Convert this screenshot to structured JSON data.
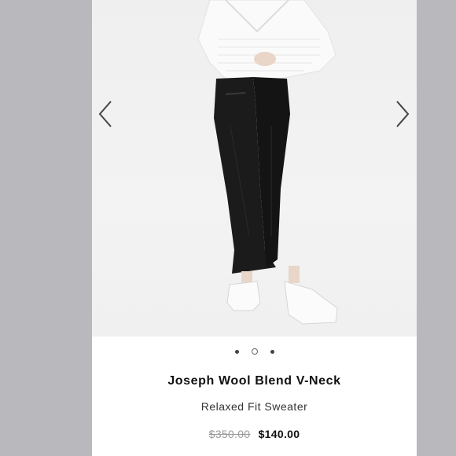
{
  "product": {
    "image_icon": "product-photo",
    "title": "Joseph Wool Blend V-Neck",
    "subtitle": "Relaxed Fit Sweater",
    "original_price": "$350.00",
    "sale_price": "$140.00"
  },
  "carousel": {
    "prev_icon": "chevron-left-icon",
    "next_icon": "chevron-right-icon",
    "dot_count": 3,
    "active_index": 1
  },
  "colors": {
    "page_background": "#b9b8bd",
    "card_background": "#ffffff",
    "sale_price": "#111111",
    "strikethrough_price": "#9a9a9a"
  }
}
